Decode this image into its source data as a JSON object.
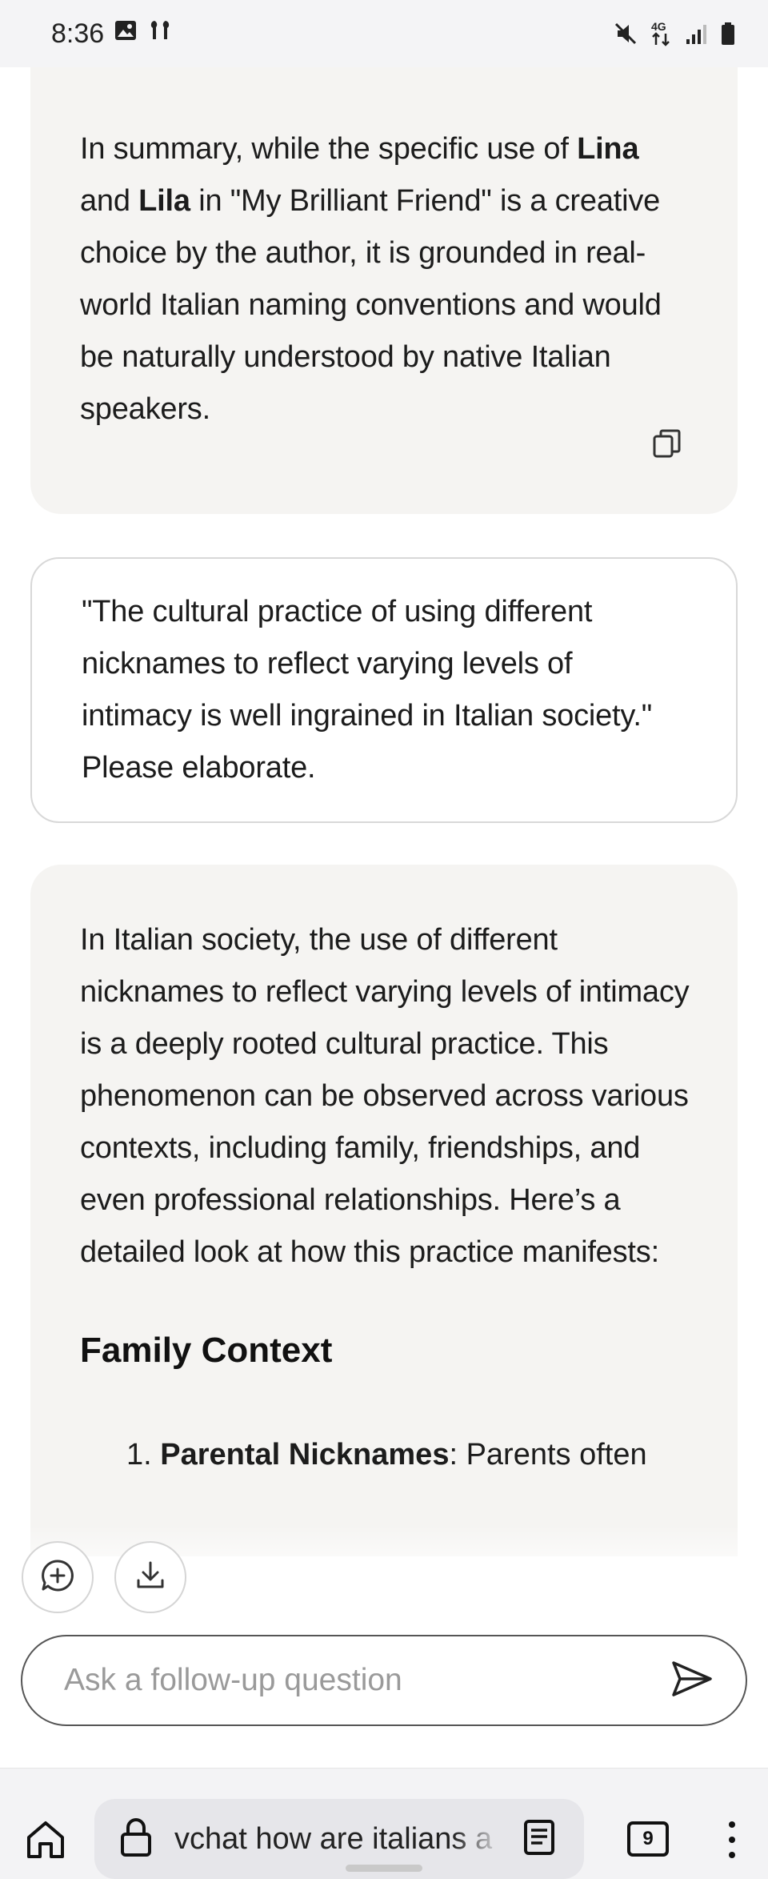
{
  "status_bar": {
    "time": "8:36",
    "network": "4G",
    "icons": [
      "gallery-icon",
      "earbuds-icon",
      "mute-icon",
      "network-icon",
      "signal-icon",
      "battery-icon"
    ]
  },
  "conversation": {
    "answer_1": {
      "paragraph_parts": [
        "In summary, while the specific use of ",
        "Lina",
        " and ",
        "Lila",
        " in \"My Brilliant Friend\" is a creative choice by the author, it is grounded in real-world Italian naming conventions and would be naturally understood by native Italian speakers."
      ]
    },
    "question": {
      "text": "\"The cultural practice of using different nicknames to reflect varying levels of intimacy is well ingrained in Italian society.\" Please elaborate."
    },
    "answer_2": {
      "intro": "In Italian society, the use of different nicknames to reflect varying levels of intimacy is a deeply rooted cultural practice. This phenomenon can be observed across various contexts, including family, friendships, and even professional relationships. Here’s a detailed look at how this practice manifests:",
      "section_heading": "Family Context",
      "list_items": [
        {
          "number": "1.",
          "term": "Parental Nicknames",
          "text": ": Parents often"
        }
      ]
    }
  },
  "followup": {
    "placeholder": "Ask a follow-up question"
  },
  "browser": {
    "url_text": "vchat how are italians a",
    "tab_count": "9"
  },
  "colors": {
    "answer_bg": "#f5f4f2",
    "status_bg": "#f4f4f6",
    "border": "#d8d8d8"
  }
}
